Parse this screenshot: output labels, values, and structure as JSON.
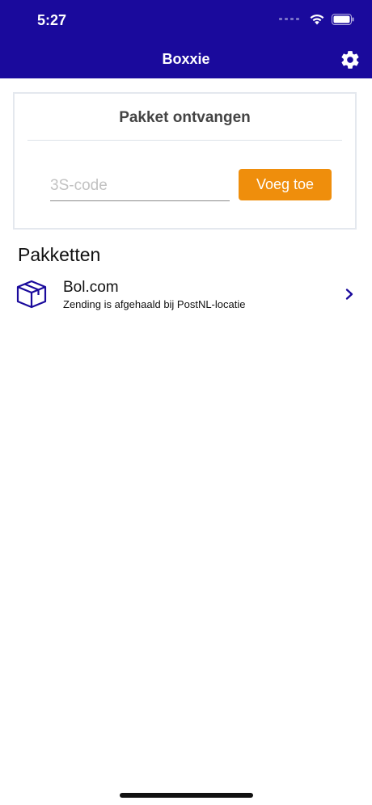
{
  "status_bar": {
    "time": "5:27"
  },
  "header": {
    "title": "Boxxie",
    "settings_icon": "gear-icon",
    "background_color": "#1a0a9c"
  },
  "receive_card": {
    "title": "Pakket ontvangen",
    "input_placeholder": "3S-code",
    "input_value": "",
    "add_button_label": "Voeg toe",
    "button_color": "#ef8e0c"
  },
  "packages": {
    "section_title": "Pakketten",
    "items": [
      {
        "name": "Bol.com",
        "status": "Zending is afgehaald bij PostNL-locatie",
        "icon": "package-box-icon"
      }
    ]
  }
}
